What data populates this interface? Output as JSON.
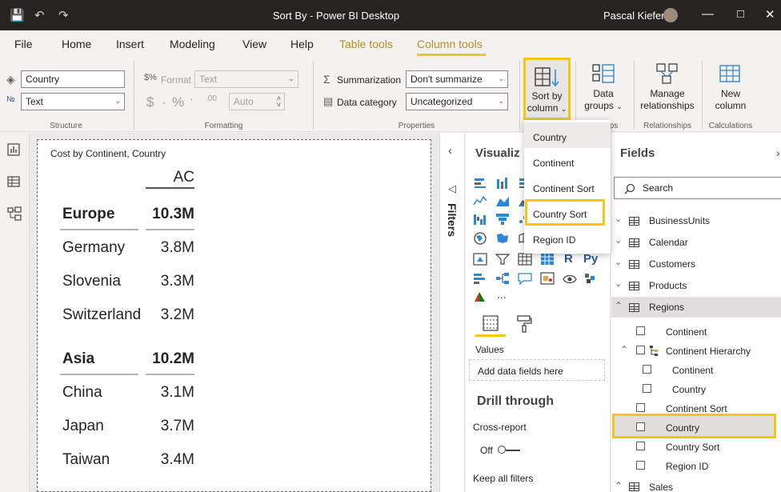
{
  "titlebar": {
    "title": "Sort By - Power BI Desktop",
    "user": "Pascal Kiefer"
  },
  "menu": [
    "File",
    "Home",
    "Insert",
    "Modeling",
    "View",
    "Help",
    "Table tools",
    "Column tools"
  ],
  "ribbon": {
    "structure": {
      "name_value": "Country",
      "type_value": "Text",
      "label": "Structure"
    },
    "formatting": {
      "format_label": "Format",
      "format_value": "Text",
      "auto_value": "Auto",
      "label": "Formatting"
    },
    "properties": {
      "summarization_label": "Summarization",
      "summarization_value": "Don't summarize",
      "data_category_label": "Data category",
      "data_category_value": "Uncategorized",
      "label": "Properties"
    },
    "sort_by_column": {
      "line1": "Sort by",
      "line2": "column"
    },
    "data_groups": {
      "line1": "Data",
      "line2": "groups",
      "group_label_tail": "ps"
    },
    "relationships": {
      "line1": "Manage",
      "line2": "relationships",
      "label": "Relationships"
    },
    "calculations": {
      "line1": "New",
      "line2": "column",
      "label": "Calculations"
    }
  },
  "sort_dropdown": [
    "Country",
    "Continent",
    "Continent Sort",
    "Country Sort",
    "Region ID"
  ],
  "visual": {
    "title": "Cost by Continent, Country",
    "column_header": "AC",
    "rows": [
      {
        "label": "Europe",
        "value": "10.3M",
        "bold": true
      },
      {
        "label": "Germany",
        "value": "3.8M"
      },
      {
        "label": "Slovenia",
        "value": "3.3M"
      },
      {
        "label": "Switzerland",
        "value": "3.2M"
      },
      {
        "label": "Asia",
        "value": "10.2M",
        "bold": true
      },
      {
        "label": "China",
        "value": "3.1M"
      },
      {
        "label": "Japan",
        "value": "3.7M"
      },
      {
        "label": "Taiwan",
        "value": "3.4M"
      }
    ]
  },
  "filters": {
    "label": "Filters"
  },
  "visualizations": {
    "title": "Visualiz",
    "values_label": "Values",
    "add_fields": "Add data fields here",
    "drill_through": "Drill through",
    "cross_report": "Cross-report",
    "off_label": "Off",
    "keep_filters": "Keep all filters",
    "more": "...",
    "r_icon": "R",
    "py_icon": "Py"
  },
  "fields": {
    "title": "Fields",
    "search_placeholder": "Search",
    "tables": [
      "BusinessUnits",
      "Calendar",
      "Customers",
      "Products",
      "Regions"
    ],
    "regions_fields": {
      "continent": "Continent",
      "hierarchy": "Continent Hierarchy",
      "h_continent": "Continent",
      "h_country": "Country",
      "continent_sort": "Continent Sort",
      "country": "Country",
      "country_sort": "Country Sort",
      "region_id": "Region ID"
    },
    "sales": "Sales"
  },
  "colors": {
    "accent": "#f2c811",
    "context_tab": "#b38f1f",
    "titlebar": "#252423"
  }
}
